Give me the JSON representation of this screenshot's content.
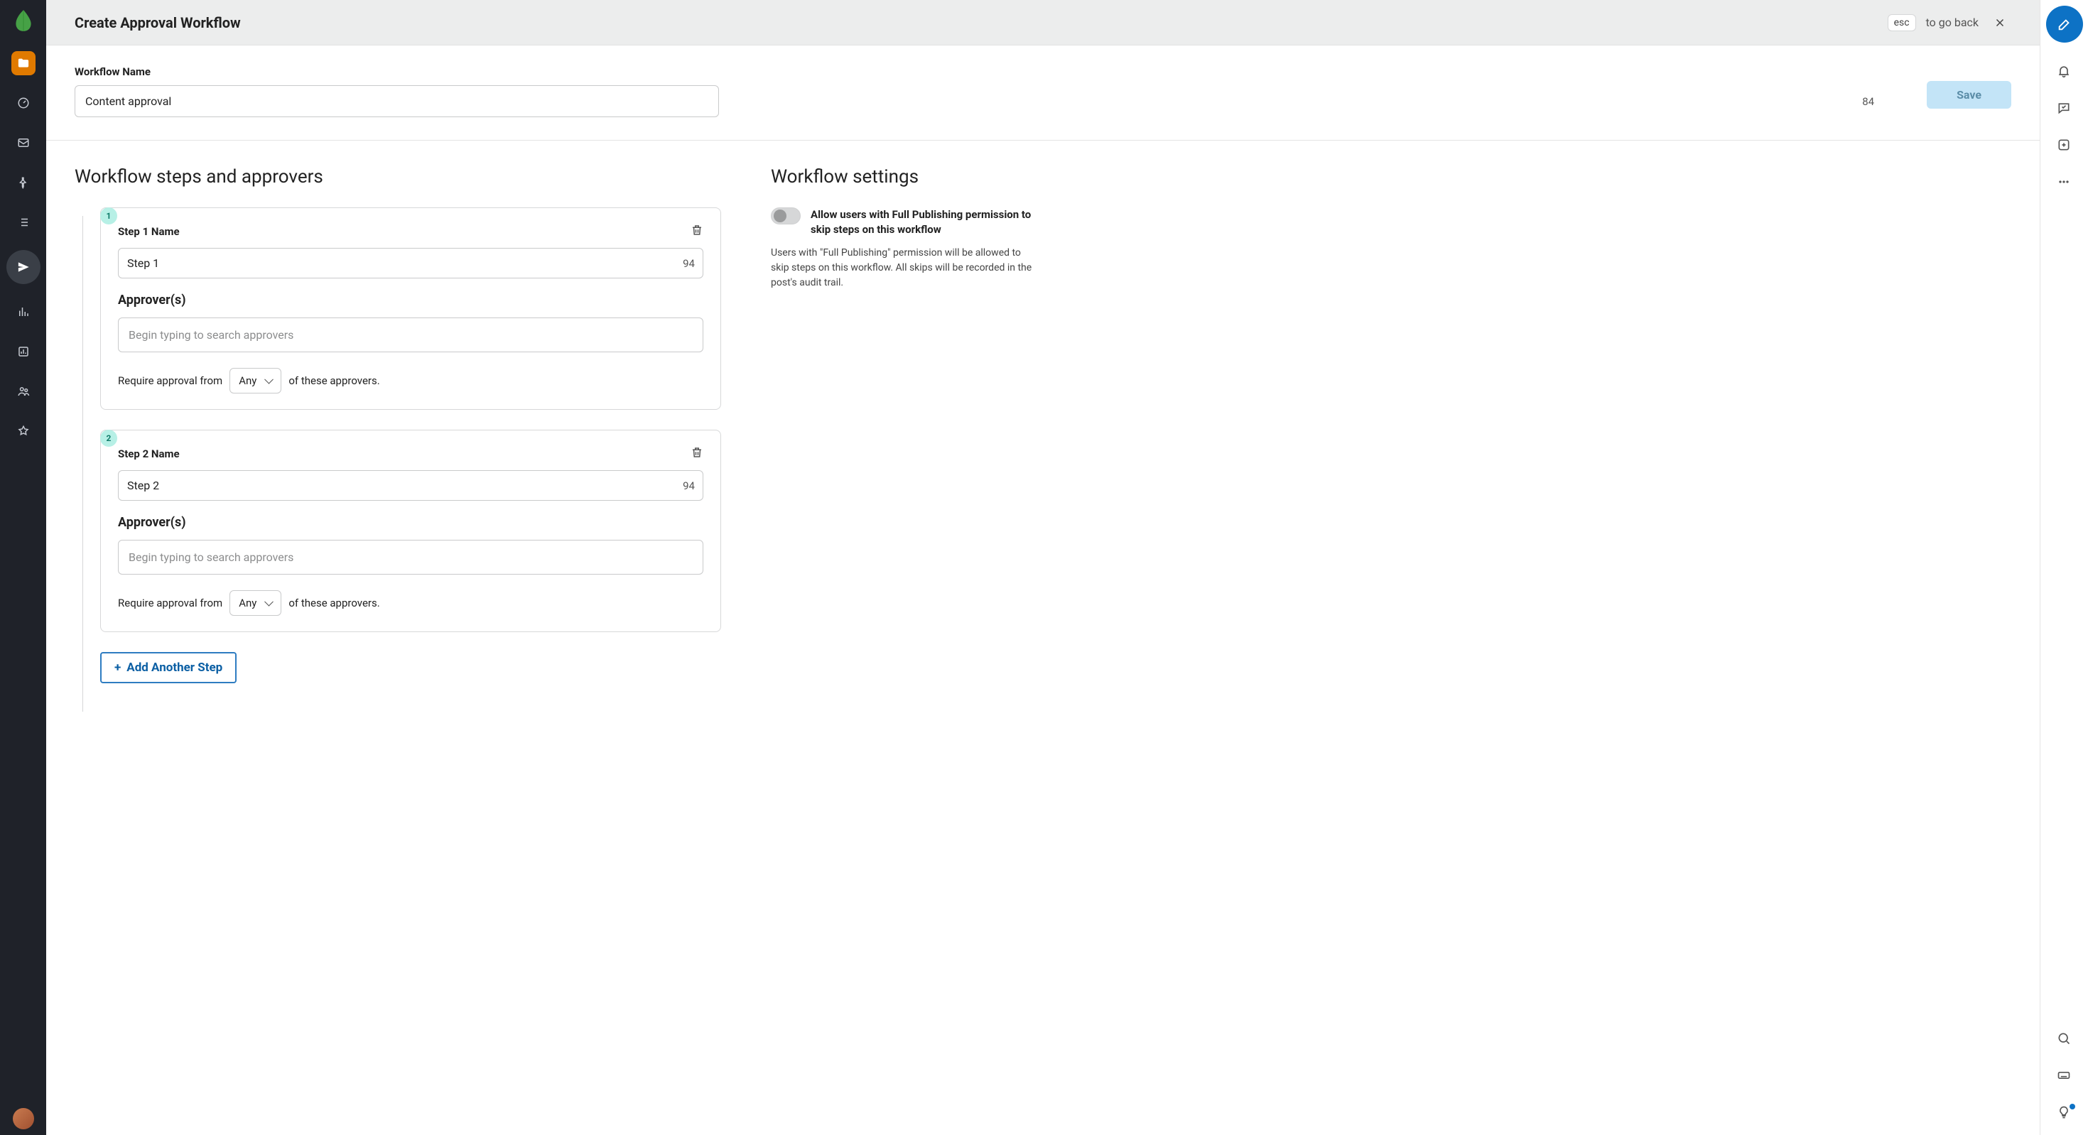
{
  "header": {
    "title": "Create Approval Workflow",
    "esc_label": "esc",
    "goback_text": "to go back"
  },
  "workflow_name": {
    "label": "Workflow Name",
    "value": "Content approval",
    "remaining": "84"
  },
  "save_label": "Save",
  "steps_section_title": "Workflow steps and approvers",
  "settings_section_title": "Workflow settings",
  "steps": [
    {
      "badge": "1",
      "name_label": "Step 1 Name",
      "name_value": "Step 1",
      "remaining": "94",
      "approvers_label": "Approver(s)",
      "approvers_placeholder": "Begin typing to search approvers",
      "require_prefix": "Require approval from",
      "require_select_value": "Any",
      "require_suffix": "of these approvers."
    },
    {
      "badge": "2",
      "name_label": "Step 2 Name",
      "name_value": "Step 2",
      "remaining": "94",
      "approvers_label": "Approver(s)",
      "approvers_placeholder": "Begin typing to search approvers",
      "require_prefix": "Require approval from",
      "require_select_value": "Any",
      "require_suffix": "of these approvers."
    }
  ],
  "add_step_label": "Add Another Step",
  "settings": {
    "allow_skip_title": "Allow users with Full Publishing permission to skip steps on this workflow",
    "allow_skip_desc": "Users with \"Full Publishing\" permission will be allowed to skip steps on this workflow. All skips will be recorded in the post's audit trail.",
    "allow_skip_checked": false
  },
  "icons": {
    "leftnav": [
      "folder",
      "gauge",
      "inbox",
      "pin",
      "list",
      "send",
      "bars",
      "chart",
      "users",
      "star"
    ],
    "rightrail_top": [
      "bell",
      "chat",
      "add-square",
      "more"
    ],
    "rightrail_bottom": [
      "search",
      "keyboard",
      "bulb"
    ]
  },
  "colors": {
    "accent_blue": "#0d72c5",
    "accent_teal": "#b7f0e6",
    "bg_header": "#eceded",
    "leftnav_bg": "#1f2229"
  }
}
